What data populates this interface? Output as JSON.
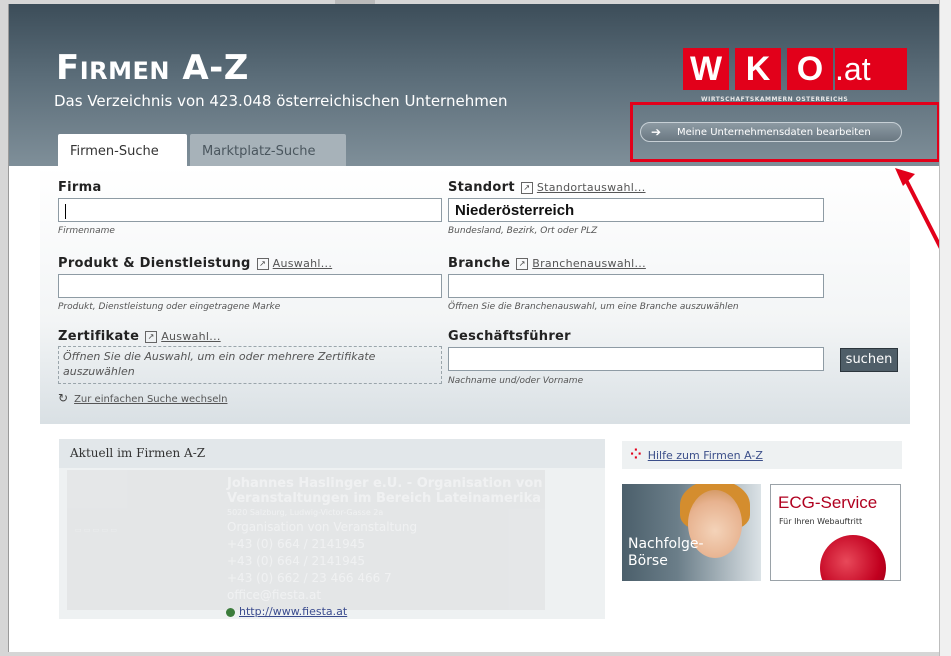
{
  "header": {
    "title": "Firmen A-Z",
    "subtitle": "Das Verzeichnis von 423.048 österreichischen Unternehmen",
    "logo": {
      "letters": [
        "W",
        "K",
        "O"
      ],
      "suffix": ".at",
      "tagline": "WIRTSCHAFTSKAMMERN ÖSTERREICHS",
      "color": "#e2001a"
    },
    "edit_button": "Meine Unternehmensdaten bearbeiten"
  },
  "tabs": [
    {
      "label": "Firmen-Suche",
      "active": true
    },
    {
      "label": "Marktplatz-Suche",
      "active": false
    }
  ],
  "form": {
    "firma": {
      "label": "Firma",
      "value": "",
      "hint": "Firmenname"
    },
    "standort": {
      "label": "Standort",
      "link": "Standortauswahl...",
      "value": "Niederösterreich",
      "hint": "Bundesland, Bezirk, Ort oder PLZ"
    },
    "produkt": {
      "label": "Produkt & Dienstleistung",
      "link": "Auswahl...",
      "value": "",
      "hint": "Produkt, Dienstleistung oder eingetragene Marke"
    },
    "branche": {
      "label": "Branche",
      "link": "Branchenauswahl...",
      "value": "",
      "hint": "Öffnen Sie die Branchenauswahl, um eine Branche auszuwählen"
    },
    "zertifikate": {
      "label": "Zertifikate",
      "link": "Auswahl...",
      "placeholder": "Öffnen Sie die Auswahl, um ein oder mehrere Zertifikate auszuwählen"
    },
    "geschaeftsfuehrer": {
      "label": "Geschäftsführer",
      "value": "",
      "hint": "Nachname und/oder Vorname"
    },
    "submit": "suchen",
    "simple_search_link": "Zur einfachen Suche wechseln"
  },
  "news": {
    "title": "Aktuell im Firmen A-Z",
    "company_line1": "Johannes Haslinger e.U. - Organisation von",
    "company_line2": "Veranstaltungen im Bereich Lateinamerika",
    "address": "5020 Salzburg, Ludwig-Victor-Gasse 2a",
    "category": "Organisation von Veranstaltung",
    "phone1": "+43 (0) 664 / 2141945",
    "phone2": "+43 (0) 664 / 2141945",
    "fax": "+43 (0) 662 / 23 466 466 7",
    "email": "office@fiesta.at",
    "web": "http://www.fiesta.at"
  },
  "sidebar": {
    "help_link": "Hilfe zum Firmen A-Z",
    "promo1_text": "Nachfolge-\nBörse",
    "promo2_title": "ECG-Service",
    "promo2_sub": "Für Ihren Webauftritt"
  }
}
